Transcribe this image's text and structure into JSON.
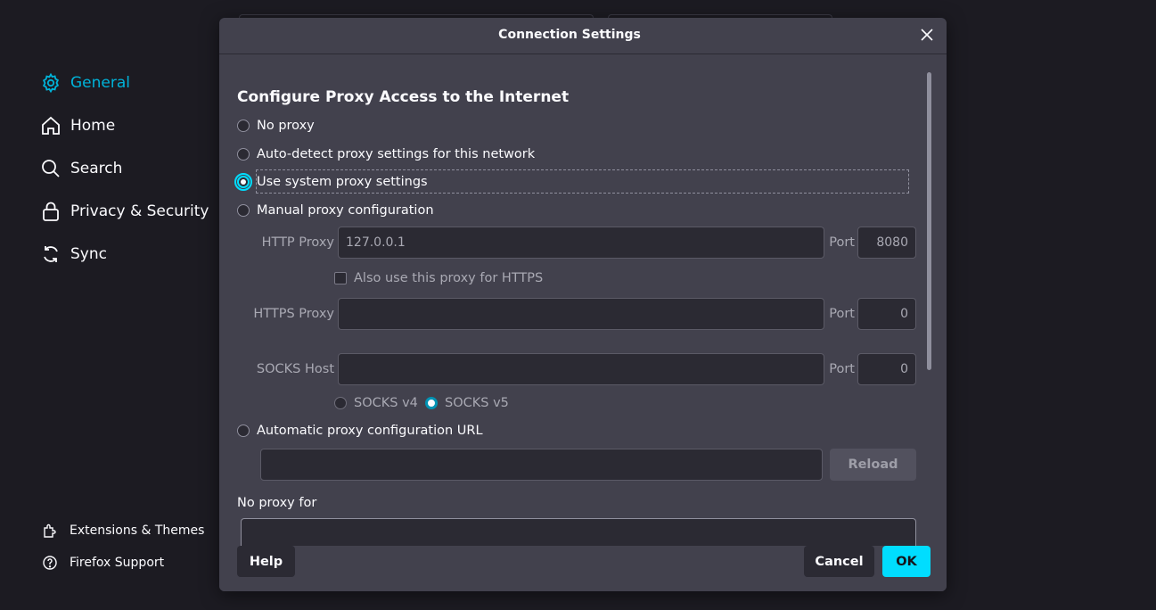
{
  "sidebar": {
    "items": [
      {
        "label": "General",
        "icon": "gear-icon",
        "active": true
      },
      {
        "label": "Home",
        "icon": "home-icon"
      },
      {
        "label": "Search",
        "icon": "search-icon"
      },
      {
        "label": "Privacy & Security",
        "icon": "lock-icon"
      },
      {
        "label": "Sync",
        "icon": "sync-icon"
      }
    ],
    "footer": [
      {
        "label": "Extensions & Themes",
        "icon": "puzzle-icon"
      },
      {
        "label": "Firefox Support",
        "icon": "help-circle-icon"
      }
    ]
  },
  "dialog": {
    "title": "Connection Settings",
    "heading": "Configure Proxy Access to the Internet",
    "options": {
      "no_proxy": "No proxy",
      "auto_detect": "Auto-detect proxy settings for this network",
      "system": "Use system proxy settings",
      "manual": "Manual proxy configuration",
      "auto_url": "Automatic proxy configuration URL"
    },
    "selected_option": "system",
    "http_proxy": {
      "label": "HTTP Proxy",
      "value": "",
      "placeholder": "127.0.0.1",
      "port_label": "Port",
      "port": "8080"
    },
    "also_https": "Also use this proxy for HTTPS",
    "https_proxy": {
      "label": "HTTPS Proxy",
      "value": "",
      "port_label": "Port",
      "port": "0"
    },
    "socks": {
      "label": "SOCKS Host",
      "value": "",
      "port_label": "Port",
      "port": "0",
      "v4": "SOCKS v4",
      "v5": "SOCKS v5",
      "selected": "v5"
    },
    "auto_url_value": "",
    "reload_label": "Reload",
    "no_proxy_for_label": "No proxy for",
    "no_proxy_for_value": "",
    "help_label": "Help",
    "cancel_label": "Cancel",
    "ok_label": "OK"
  },
  "colors": {
    "accent": "#00ddff",
    "active_nav": "#00b3d9",
    "dialog_bg": "#42414d",
    "page_bg": "#1c1b22"
  }
}
